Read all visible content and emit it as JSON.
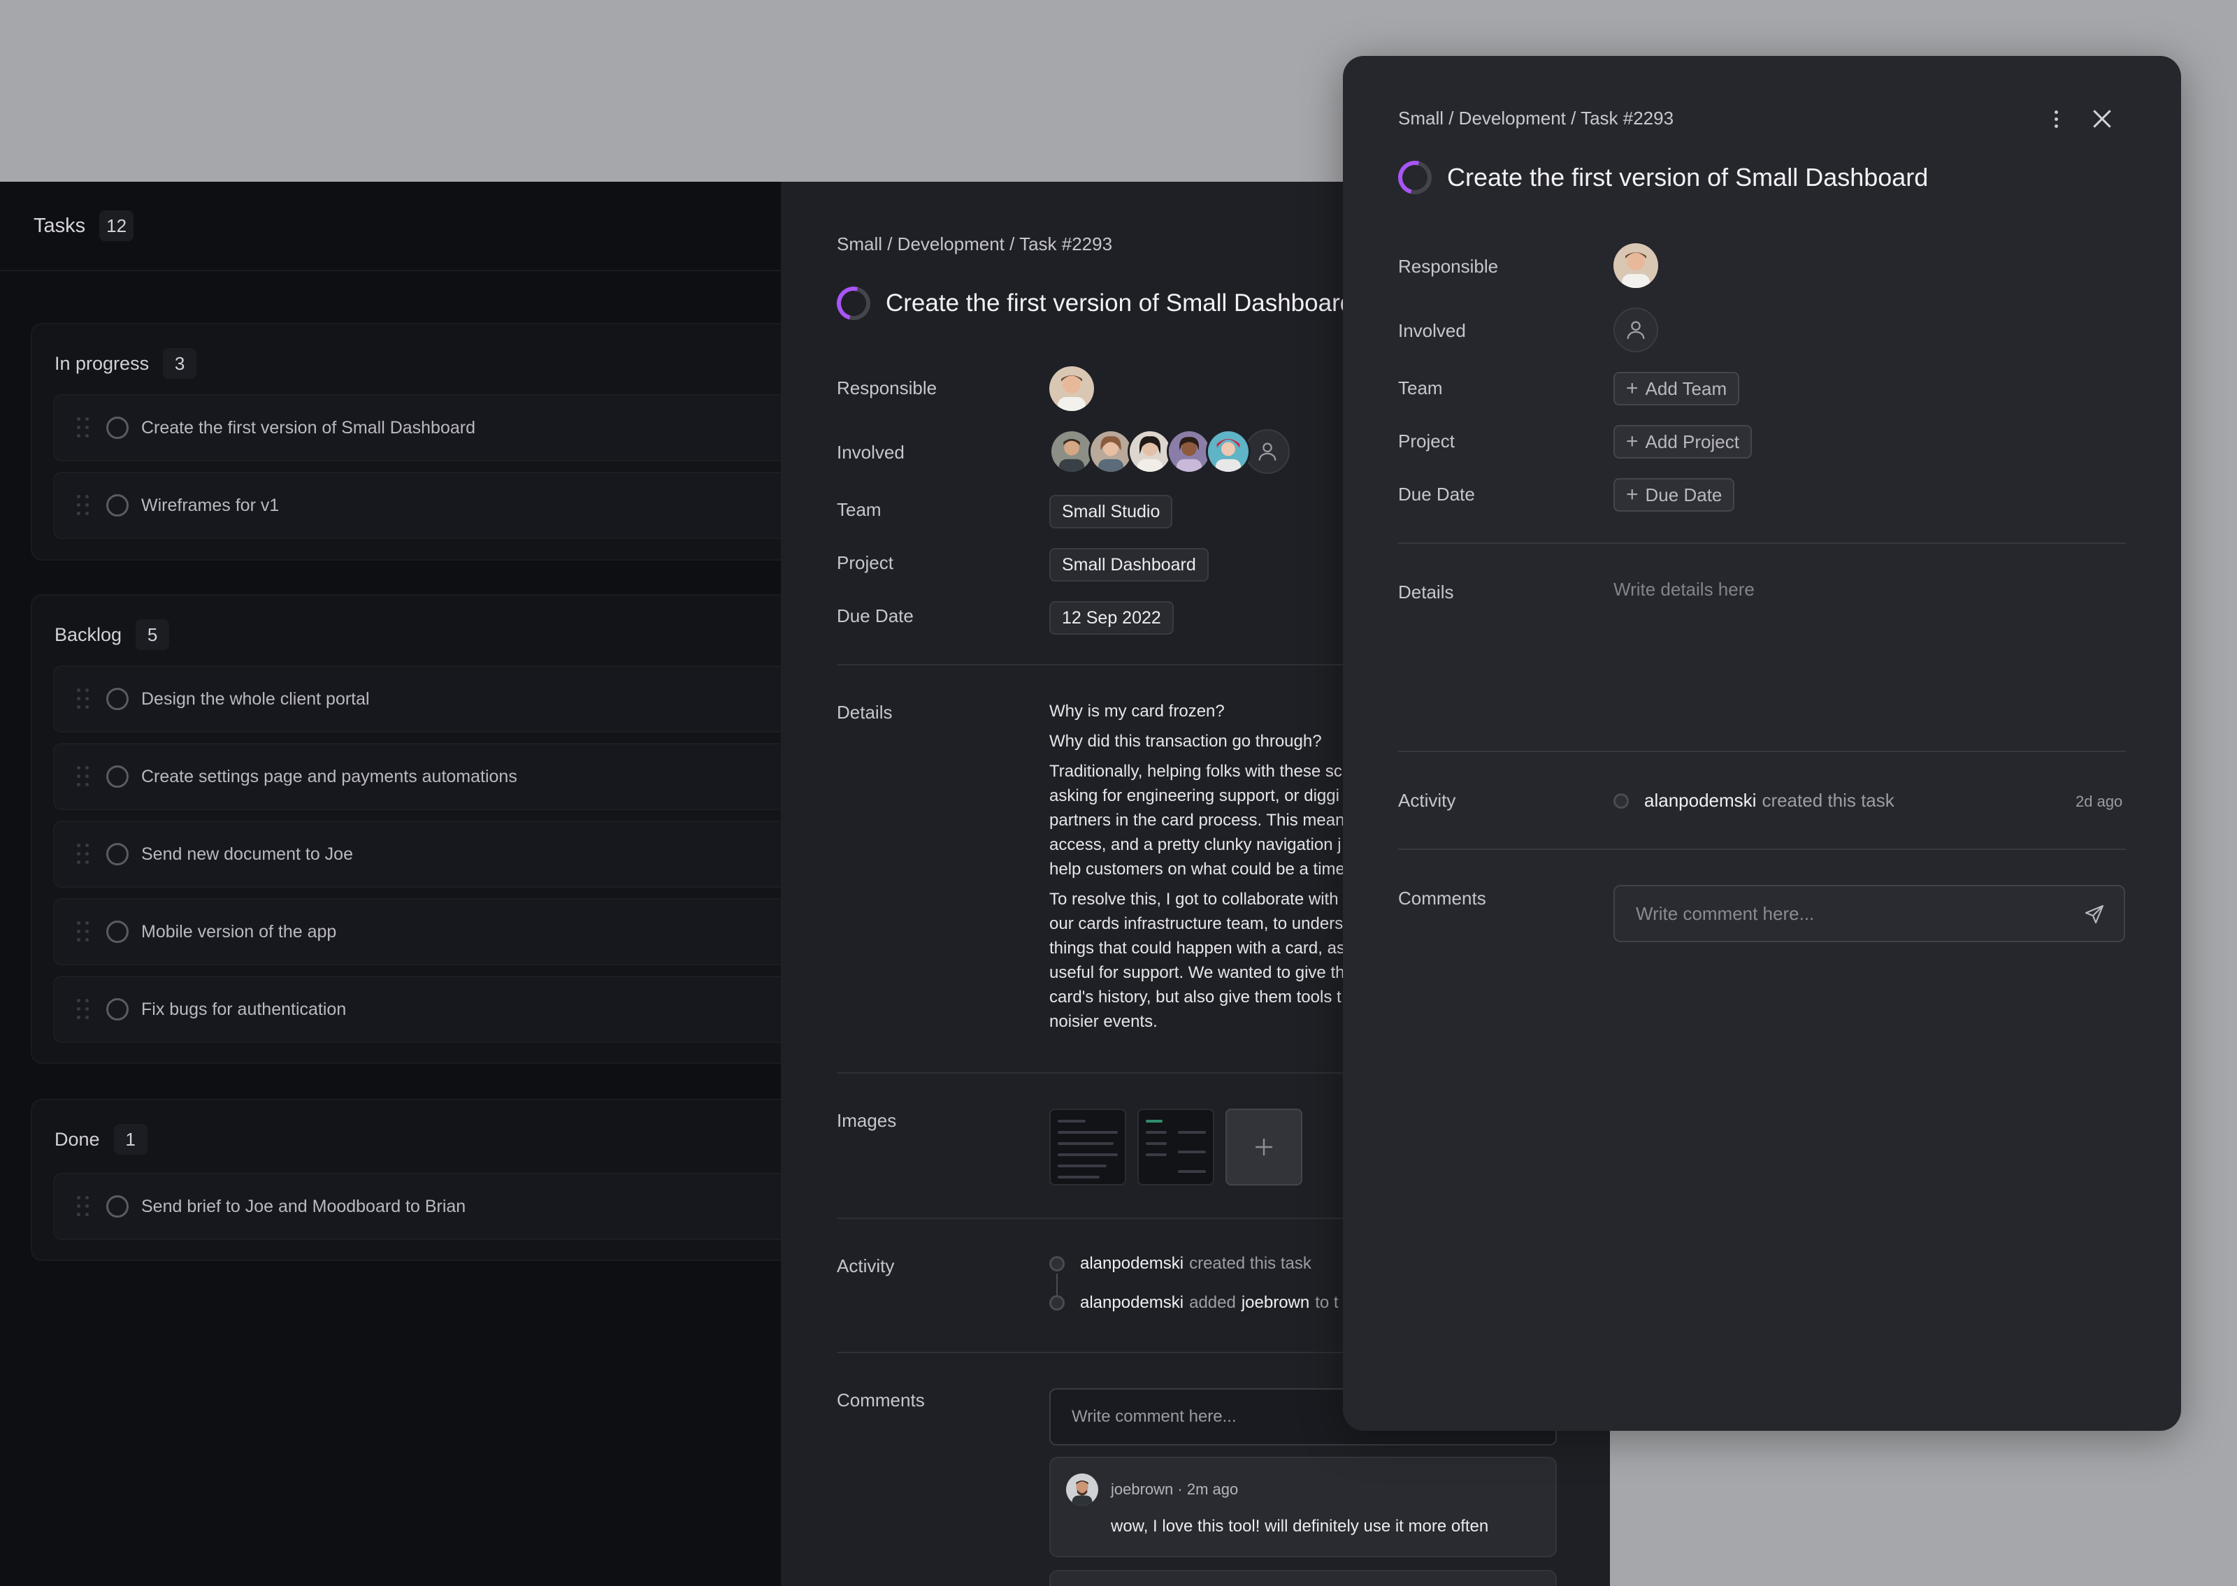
{
  "board": {
    "title": "Tasks",
    "count": "12",
    "groups": [
      {
        "title": "In progress",
        "count": "3",
        "tasks": [
          "Create the first version of Small Dashboard",
          "Wireframes for v1"
        ]
      },
      {
        "title": "Backlog",
        "count": "5",
        "tasks": [
          "Design the whole client portal",
          "Create settings page and payments automations",
          "Send new document to Joe",
          "Mobile version of the app",
          "Fix bugs for authentication"
        ]
      },
      {
        "title": "Done",
        "count": "1",
        "tasks": [
          "Send brief to Joe and Moodboard to Brian"
        ]
      }
    ]
  },
  "detail": {
    "breadcrumb": "Small / Development / Task #2293",
    "title": "Create the first version of Small Dashboard",
    "labels": {
      "responsible": "Responsible",
      "involved": "Involved",
      "team": "Team",
      "project": "Project",
      "due_date": "Due Date",
      "details": "Details",
      "images": "Images",
      "activity": "Activity",
      "comments": "Comments"
    },
    "team": "Small Studio",
    "project": "Small Dashboard",
    "due_date": "12 Sep 2022",
    "details": [
      "Why is my card frozen?",
      "Why did this transaction go through?",
      "Traditionally, helping folks with these sc",
      "asking for engineering support, or diggi",
      "partners in the card process. This mean",
      "access, and a pretty clunky navigation j",
      "help customers on what could be a time",
      "To resolve this, I got to collaborate with",
      "our cards infrastructure team, to unders",
      "things that could happen with a card, as",
      "useful for support. We wanted to give th",
      "card's history, but also give them tools t",
      "noisier events."
    ],
    "activity": [
      {
        "user": "alanpodemski",
        "action": "created this task",
        "target": ""
      },
      {
        "user": "alanpodemski",
        "action": "added",
        "target": "joebrown",
        "suffix": "to t"
      }
    ],
    "comment_placeholder": "Write comment here...",
    "comment": {
      "author_meta": "joebrown · 2m ago",
      "text": "wow, I love this tool! will definitely use it more often"
    }
  },
  "overlay": {
    "breadcrumb": "Small / Development / Task #2293",
    "title": "Create the first version of Small Dashboard",
    "labels": {
      "responsible": "Responsible",
      "involved": "Involved",
      "team": "Team",
      "project": "Project",
      "due_date": "Due Date",
      "details": "Details",
      "activity": "Activity",
      "comments": "Comments"
    },
    "add_team": "Add Team",
    "add_project": "Add Project",
    "add_due_date": "Due Date",
    "details_placeholder": "Write details here",
    "activity": {
      "user": "alanpodemski",
      "action": "created this task",
      "time": "2d ago"
    },
    "comment_placeholder": "Write comment here..."
  },
  "colors": {
    "accent": "#a855f7",
    "board_bg": "#0e0f12",
    "panel_bg": "#1f2025",
    "overlay_bg": "#26272c",
    "backdrop": "#a6a7aa"
  },
  "icons": {
    "more": "vertical-ellipsis-icon",
    "close": "close-icon",
    "send": "send-icon",
    "add": "plus-icon",
    "drag": "drag-handle-icon",
    "status": "in-progress-ring-icon",
    "user": "user-placeholder-icon"
  }
}
